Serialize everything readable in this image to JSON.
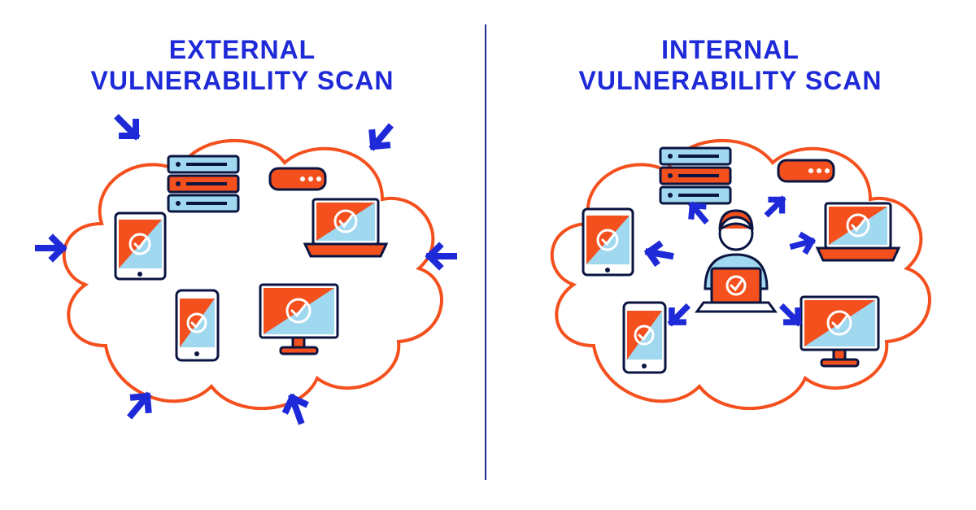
{
  "left": {
    "title": "EXTERNAL\nVULNERABILITY SCAN"
  },
  "right": {
    "title": "INTERNAL\nVULNERABILITY SCAN"
  },
  "colors": {
    "blue": "#1e2ad8",
    "orange": "#f4501e",
    "lightblue": "#a0d8f0",
    "dark": "#0a1440"
  }
}
